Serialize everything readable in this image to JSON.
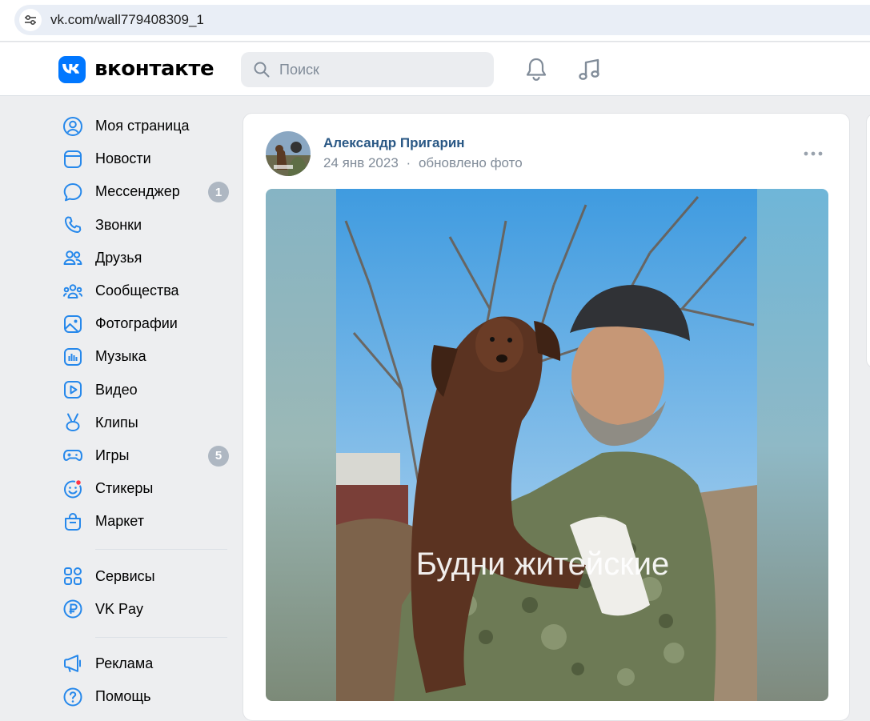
{
  "browser": {
    "url": "vk.com/wall779408309_1"
  },
  "header": {
    "brand": "вконтакте",
    "search_placeholder": "Поиск"
  },
  "nav": {
    "items": [
      {
        "label": "Моя страница",
        "icon": "user-circle-icon"
      },
      {
        "label": "Новости",
        "icon": "news-icon"
      },
      {
        "label": "Мессенджер",
        "icon": "message-icon",
        "badge": "1"
      },
      {
        "label": "Звонки",
        "icon": "phone-icon"
      },
      {
        "label": "Друзья",
        "icon": "friends-icon"
      },
      {
        "label": "Сообщества",
        "icon": "communities-icon"
      },
      {
        "label": "Фотографии",
        "icon": "photos-icon"
      },
      {
        "label": "Музыка",
        "icon": "music-icon"
      },
      {
        "label": "Видео",
        "icon": "video-icon"
      },
      {
        "label": "Клипы",
        "icon": "clips-icon"
      },
      {
        "label": "Игры",
        "icon": "games-icon",
        "badge": "5"
      },
      {
        "label": "Стикеры",
        "icon": "stickers-icon"
      },
      {
        "label": "Маркет",
        "icon": "market-icon"
      }
    ],
    "items2": [
      {
        "label": "Сервисы",
        "icon": "services-icon"
      },
      {
        "label": "VK Pay",
        "icon": "vkpay-icon"
      }
    ],
    "items3": [
      {
        "label": "Реклама",
        "icon": "ads-icon"
      },
      {
        "label": "Помощь",
        "icon": "help-icon"
      }
    ]
  },
  "post": {
    "author": "Александр Пригарин",
    "date": "24 янв 2023",
    "separator": "·",
    "action": "обновлено фото",
    "photo_caption": "Будни житейские"
  },
  "colors": {
    "vk_blue": "#0077ff",
    "link": "#2a5885",
    "muted": "#818c99",
    "bg": "#edeef0"
  }
}
